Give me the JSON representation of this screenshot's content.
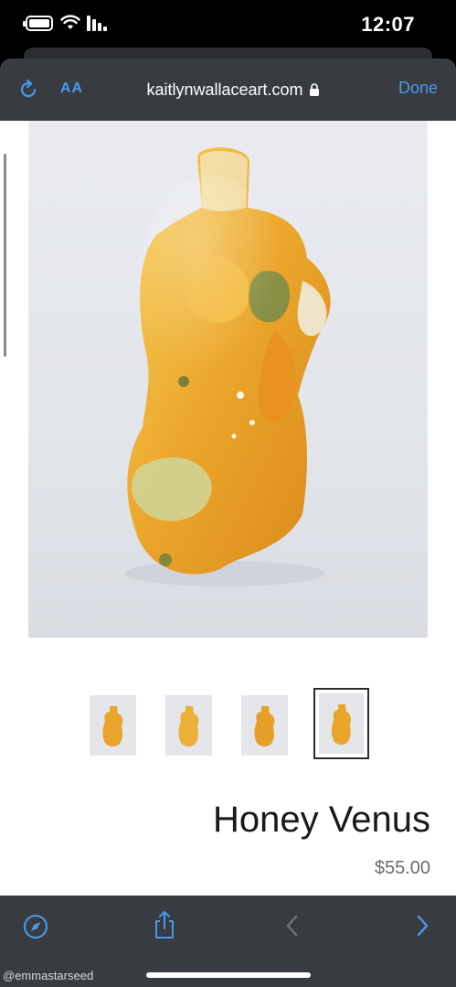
{
  "status_bar": {
    "time": "12:07",
    "icons": [
      "battery-icon",
      "wifi-icon",
      "signal-icon"
    ]
  },
  "browser": {
    "aa_label": "AA",
    "url": "kaitlynwallaceart.com",
    "done_label": "Done",
    "accent_color": "#4a98ec",
    "icons": [
      "reload-icon",
      "lock-icon"
    ]
  },
  "product": {
    "title": "Honey Venus",
    "price": "$55.00",
    "thumbnail_count": 4,
    "selected_thumbnail": 4
  },
  "toolbar": {
    "icons": [
      "compass-icon",
      "share-icon",
      "back-icon",
      "forward-icon"
    ]
  },
  "watermark": "@emmastarseed"
}
